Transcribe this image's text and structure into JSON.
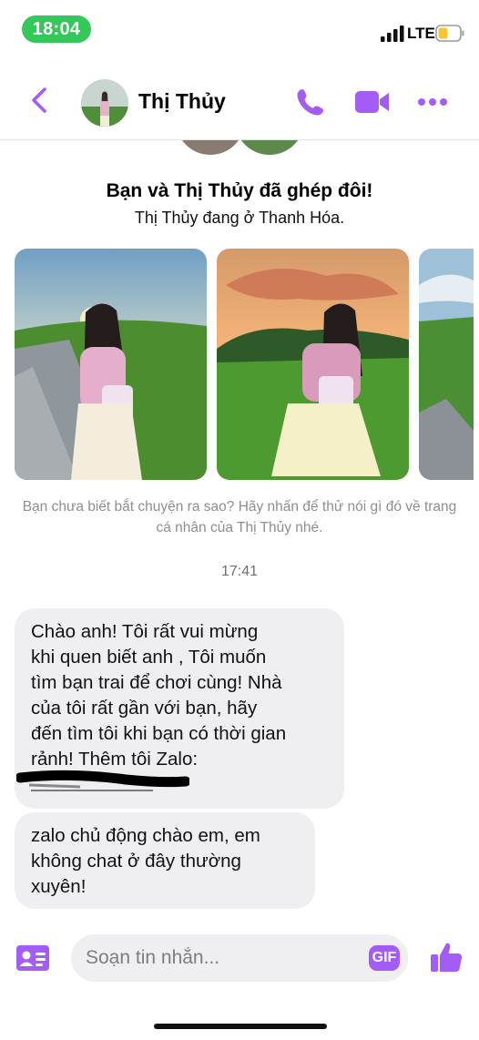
{
  "status_bar": {
    "time": "18:04",
    "network": "LTE"
  },
  "header": {
    "contact_name": "Thị Thủy"
  },
  "match": {
    "title": "Bạn và Thị Thủy đã ghép đôi!",
    "subtitle": "Thị Thủy đang ở Thanh Hóa."
  },
  "hint": "Bạn chưa biết bắt chuyện ra sao? Hãy nhấn để thử nói gì đó về trang cá nhân của Thị Thủy nhé.",
  "timestamp": "17:41",
  "messages": [
    {
      "lines": [
        "Chào anh!  Tôi rất vui mừng",
        "khi quen biết anh ,   Tôi muốn",
        "tìm bạn trai để chơi cùng! Nhà",
        "của tôi rất gần với bạn, hãy",
        "đến tìm tôi khi bạn có thời gian",
        "rảnh! Thêm tôi Zalo:"
      ]
    },
    {
      "lines": [
        "zalo chủ động chào em, em",
        "không chat ở đây thường",
        "xuyên!"
      ]
    }
  ],
  "composer": {
    "placeholder": "Soạn tin nhắn...",
    "gif_label": "GIF"
  },
  "colors": {
    "accent": "#a35cf5",
    "bubble": "#efeff2",
    "status_pill": "#34c759"
  }
}
